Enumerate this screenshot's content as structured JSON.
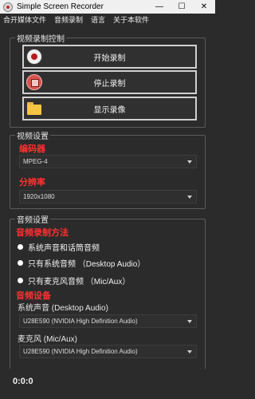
{
  "window": {
    "title": "Simple Screen Recorder",
    "controls": [
      "—",
      "☐",
      "✕"
    ]
  },
  "menu": [
    "合开媒体文件",
    "音频录制",
    "语言",
    "关于本软件"
  ],
  "video_record_group": {
    "title": "视频录制控制",
    "buttons": {
      "start": "开始录制",
      "stop": "停止录制",
      "show": "显示录像"
    }
  },
  "video_settings": {
    "title": "视频设置",
    "encoder_label": "编码器",
    "encoder_value": "MPEG-4",
    "resolution_label": "分辨率",
    "resolution_value": "1920x1080"
  },
  "audio_settings": {
    "title": "音频设置",
    "method_label": "音频录制方法",
    "options": [
      "系统声音和话筒音频",
      "只有系统音频 （Desktop Audio）",
      "只有麦克风音频 （Mic/Aux）"
    ],
    "device_label": "音频设备",
    "system_sound_label": "系统声音 (Desktop Audio)",
    "system_sound_value": "U28E590 (NVIDIA High Definition Audio)",
    "mic_label": "麦克风 (Mic/Aux)",
    "mic_value": "U28E590 (NVIDIA High Definition Audio)"
  },
  "status": {
    "timer": "0:0:0"
  }
}
